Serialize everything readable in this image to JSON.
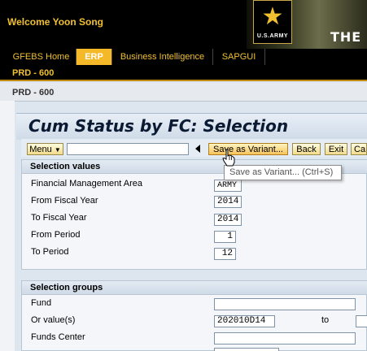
{
  "header": {
    "welcome": "Welcome Yoon Song",
    "logo_text": "U.S.ARMY",
    "banner_text": "THE"
  },
  "nav": {
    "tabs": [
      {
        "label": "GFEBS Home",
        "active": false
      },
      {
        "label": "ERP",
        "active": true
      },
      {
        "label": "Business Intelligence",
        "active": false
      },
      {
        "label": "SAPGUI",
        "active": false
      }
    ],
    "subnav_label": "PRD - 600"
  },
  "page": {
    "strip_label": "PRD - 600",
    "title": "Cum Status by FC: Selection"
  },
  "toolbar": {
    "menu_label": "Menu",
    "menu_icon": "chevron-down-icon",
    "save_variant_label": "Save as Variant...",
    "back_label": "Back",
    "exit_label": "Exit",
    "cancel_label": "Ca"
  },
  "tooltip": {
    "text": "Save as Variant... (Ctrl+S)"
  },
  "selection_values": {
    "heading": "Selection values",
    "fields": [
      {
        "label": "Financial Management Area",
        "value": "ARMY"
      },
      {
        "label": "From Fiscal Year",
        "value": "2014"
      },
      {
        "label": "To Fiscal Year",
        "value": "2014"
      },
      {
        "label": "From Period",
        "value": "1"
      },
      {
        "label": "To Period",
        "value": "12"
      }
    ]
  },
  "selection_groups": {
    "heading": "Selection groups",
    "fields": [
      {
        "label": "Fund",
        "value": ""
      },
      {
        "label": "Or value(s)",
        "value": "202010D14",
        "to_label": "to",
        "to_value": ""
      },
      {
        "label": "Funds Center",
        "value": ""
      }
    ]
  },
  "colors": {
    "header_bg": "#000000",
    "nav_text": "#f0c030",
    "nav_active_bg": "#f5b829",
    "button_bg": "#f2dc8a",
    "panel_bg": "#f4f6f9"
  }
}
